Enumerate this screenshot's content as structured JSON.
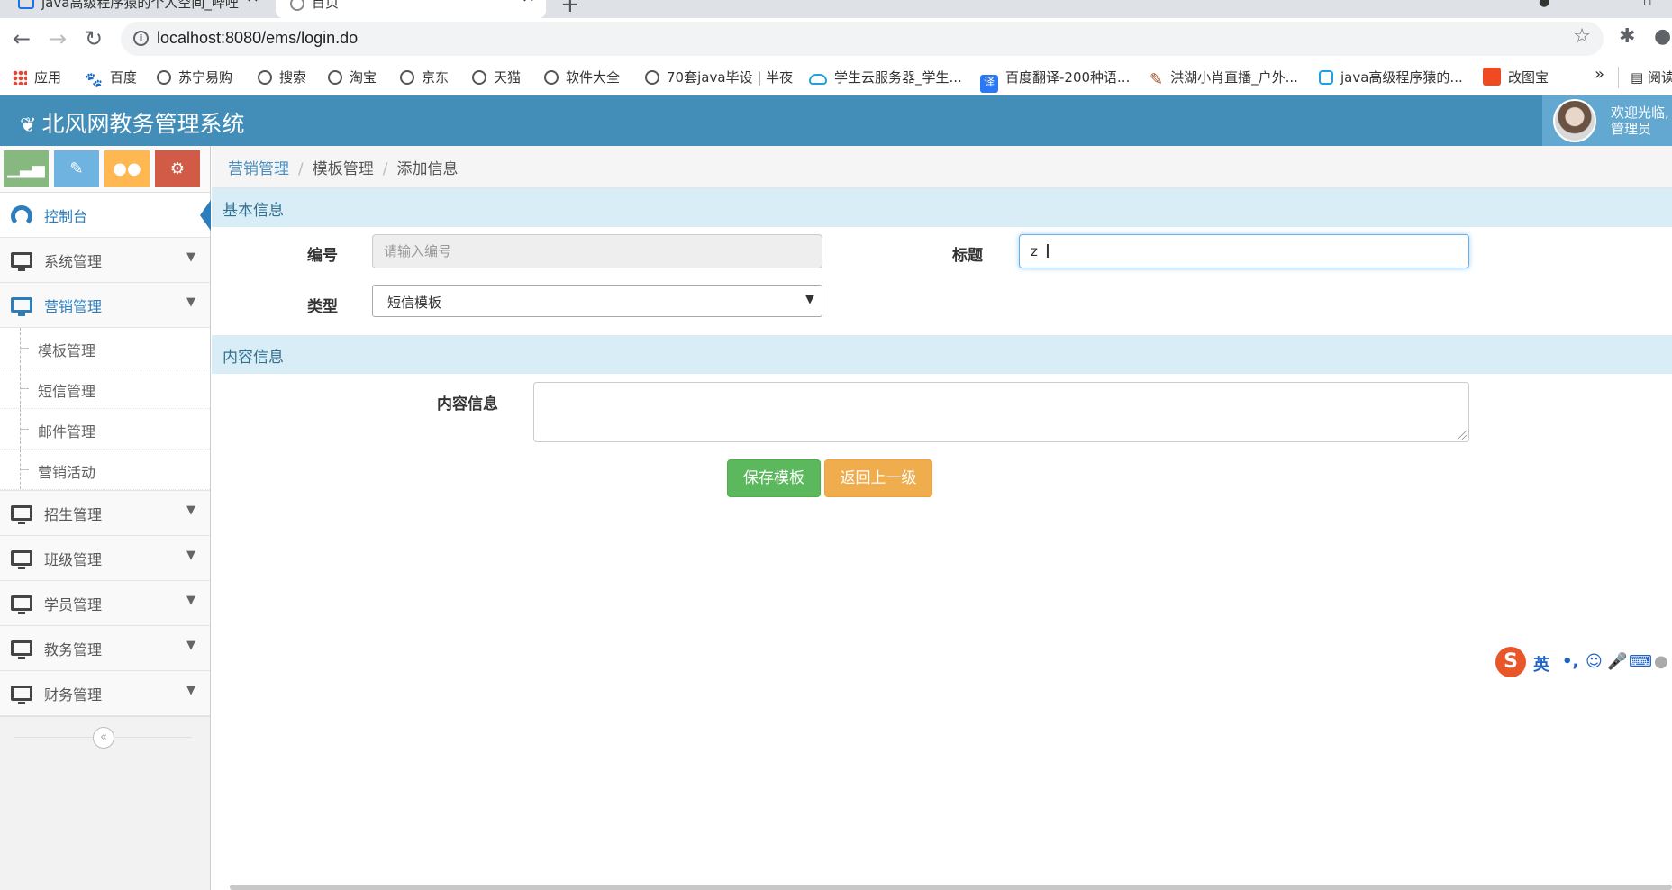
{
  "browser": {
    "tabs": [
      {
        "title": "java高级程序猿的个人空间_哔哩"
      },
      {
        "title": "首页"
      }
    ],
    "url": "localhost:8080/ems/login.do",
    "bookmarks": [
      "应用",
      "百度",
      "苏宁易购",
      "搜索",
      "淘宝",
      "京东",
      "天猫",
      "软件大全",
      "70套java毕设 | 半夜",
      "学生云服务器_学生...",
      "百度翻译-200种语...",
      "洪湖小肖直播_户外...",
      "java高级程序猿的...",
      "改图宝"
    ],
    "bookmark_more": "»",
    "reading_list": "阅读"
  },
  "app": {
    "title": "北风网教务管理系统",
    "user": {
      "greeting": "欢迎光临,",
      "role": "管理员"
    },
    "colors": {
      "header": "#438eb9",
      "accent": "#2b7dbc",
      "success": "#5cb85c",
      "warning": "#f0ad4e"
    }
  },
  "sidebar": {
    "shortcuts": [
      {
        "icon": "signal-icon",
        "color": "#87b87f"
      },
      {
        "icon": "pencil-icon",
        "color": "#6fb3e0"
      },
      {
        "icon": "users-icon",
        "color": "#ffb752"
      },
      {
        "icon": "cogs-icon",
        "color": "#d15b47"
      }
    ],
    "dashboard": "控制台",
    "menus": [
      {
        "label": "系统管理"
      },
      {
        "label": "营销管理",
        "open": true,
        "children": [
          "模板管理",
          "短信管理",
          "邮件管理",
          "营销活动"
        ]
      },
      {
        "label": "招生管理"
      },
      {
        "label": "班级管理"
      },
      {
        "label": "学员管理"
      },
      {
        "label": "教务管理"
      },
      {
        "label": "财务管理"
      }
    ]
  },
  "breadcrumb": [
    "营销管理",
    "模板管理",
    "添加信息"
  ],
  "form": {
    "section_basic": "基本信息",
    "id_label": "编号",
    "id_placeholder": "请输入编号",
    "title_label": "标题",
    "title_value": "z",
    "type_label": "类型",
    "type_value": "短信模板",
    "section_content": "内容信息",
    "content_label": "内容信息",
    "save_button": "保存模板",
    "back_button": "返回上一级"
  },
  "ime": {
    "logo": "S",
    "mode": "英",
    "punct": "•,"
  }
}
